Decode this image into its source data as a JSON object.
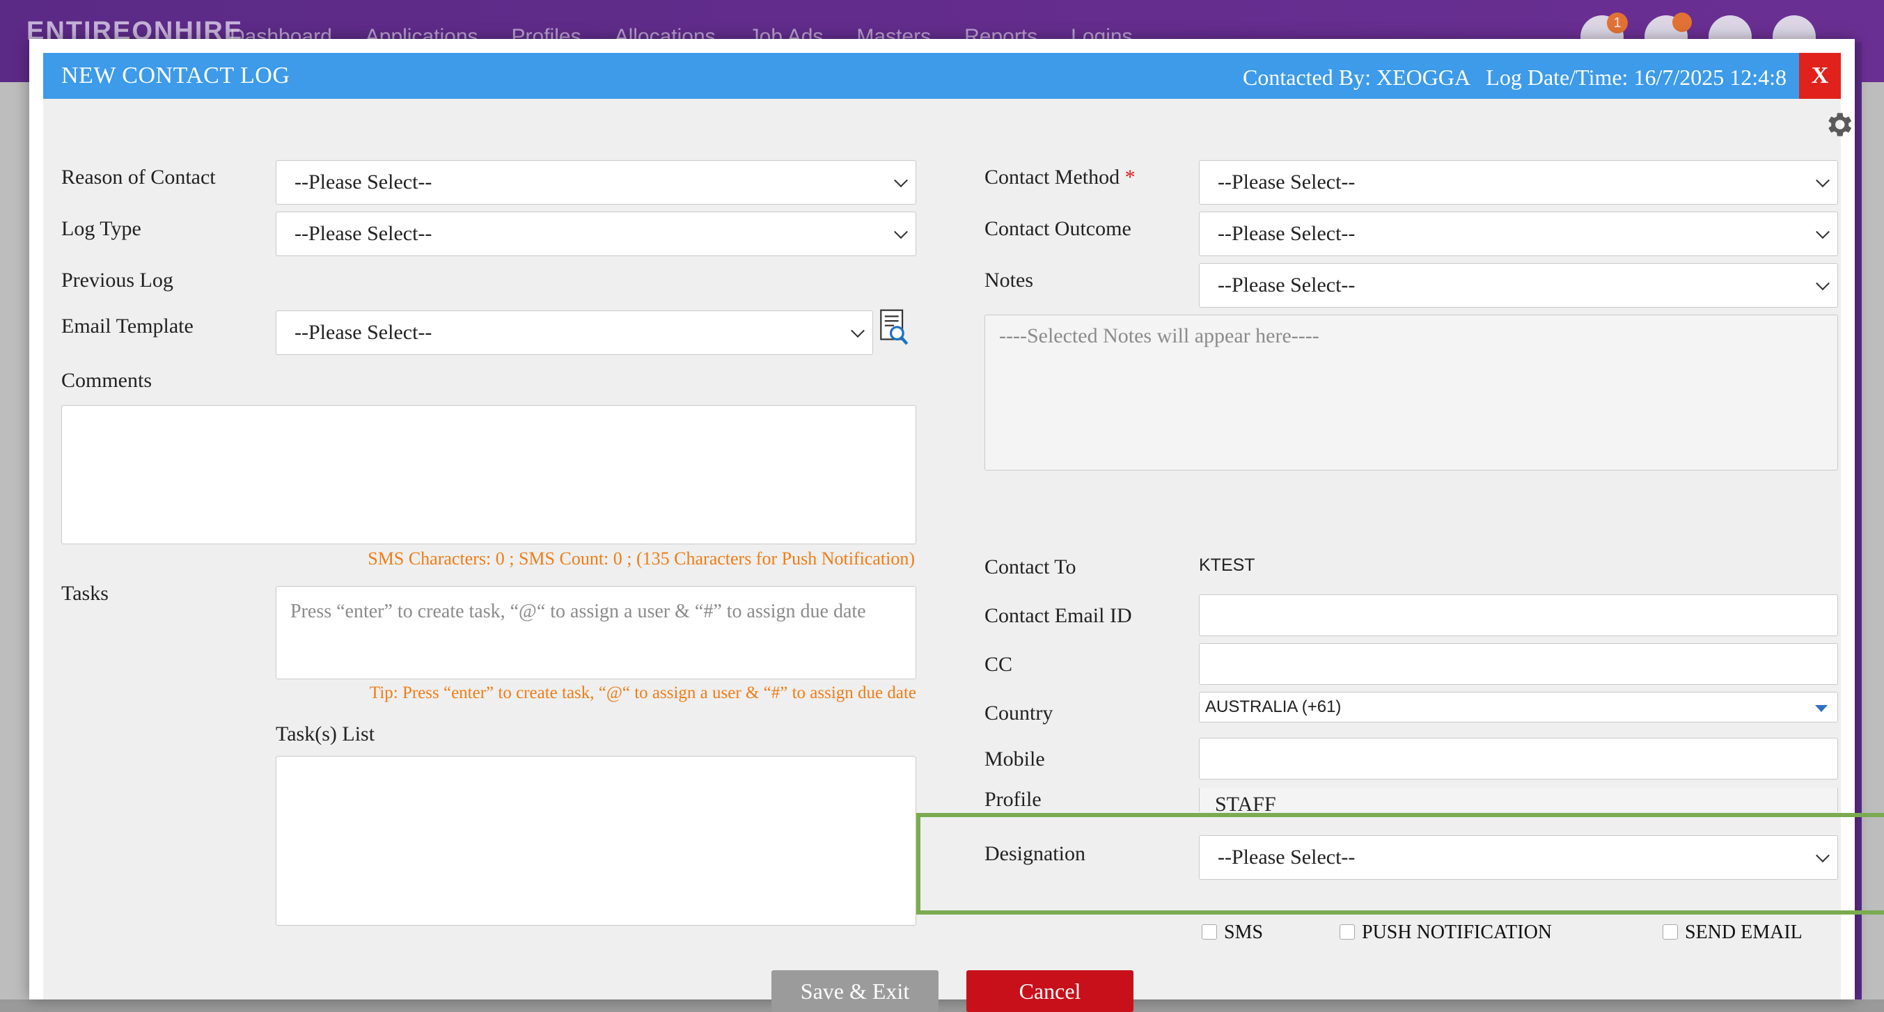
{
  "app": {
    "brand": "ENTIREONHIRE",
    "nav": [
      "Dashboard",
      "Applications",
      "Profiles",
      "Allocations",
      "Job Ads",
      "Masters",
      "Reports",
      "Logins"
    ],
    "notification_count": "1"
  },
  "modal": {
    "title": "NEW CONTACT LOG",
    "meta": "Contacted By: XEOGGA   Log Date/Time: 16/7/2025 12:4:8",
    "close_label": "X"
  },
  "left": {
    "reason_label": "Reason of Contact",
    "reason_value": "--Please Select--",
    "logtype_label": "Log Type",
    "logtype_value": "--Please Select--",
    "previous_log_label": "Previous Log",
    "email_template_label": "Email Template",
    "email_template_value": "--Please Select--",
    "comments_label": "Comments",
    "sms_info": "SMS Characters: 0 ; SMS Count: 0 ; (135 Characters for Push Notification)",
    "tasks_label": "Tasks",
    "tasks_placeholder": "Press “enter” to create task, “@“ to assign a user & “#” to assign due date",
    "tasks_tip": "Tip: Press “enter” to create task, “@“ to assign a user & “#” to assign due date",
    "tasks_list_label": "Task(s) List"
  },
  "right": {
    "method_label": "Contact Method",
    "method_required": "*",
    "method_value": "--Please Select--",
    "outcome_label": "Contact Outcome",
    "outcome_value": "--Please Select--",
    "notes_label": "Notes",
    "notes_value": "--Please Select--",
    "notes_placeholder": "----Selected Notes will appear here----",
    "contact_to_label": "Contact To",
    "contact_to_value": "KTEST",
    "email_label": "Contact Email ID",
    "email_value": "",
    "cc_label": "CC",
    "cc_value": "",
    "country_label": "Country",
    "country_value": "AUSTRALIA (+61)",
    "mobile_label": "Mobile",
    "mobile_value": "",
    "profile_label": "Profile",
    "profile_value": "STAFF",
    "designation_label": "Designation",
    "designation_value": "--Please Select--"
  },
  "options": {
    "sms": "SMS",
    "push": "PUSH NOTIFICATION",
    "send_email": "SEND EMAIL"
  },
  "buttons": {
    "save": "Save & Exit",
    "cancel": "Cancel"
  },
  "colors": {
    "header_blue": "#3d9be9",
    "close_red": "#e0211c",
    "cancel_red": "#c8101a",
    "save_grey": "#9b9b9b",
    "highlight_green": "#7aab4f",
    "hint_orange": "#ef7d16"
  }
}
